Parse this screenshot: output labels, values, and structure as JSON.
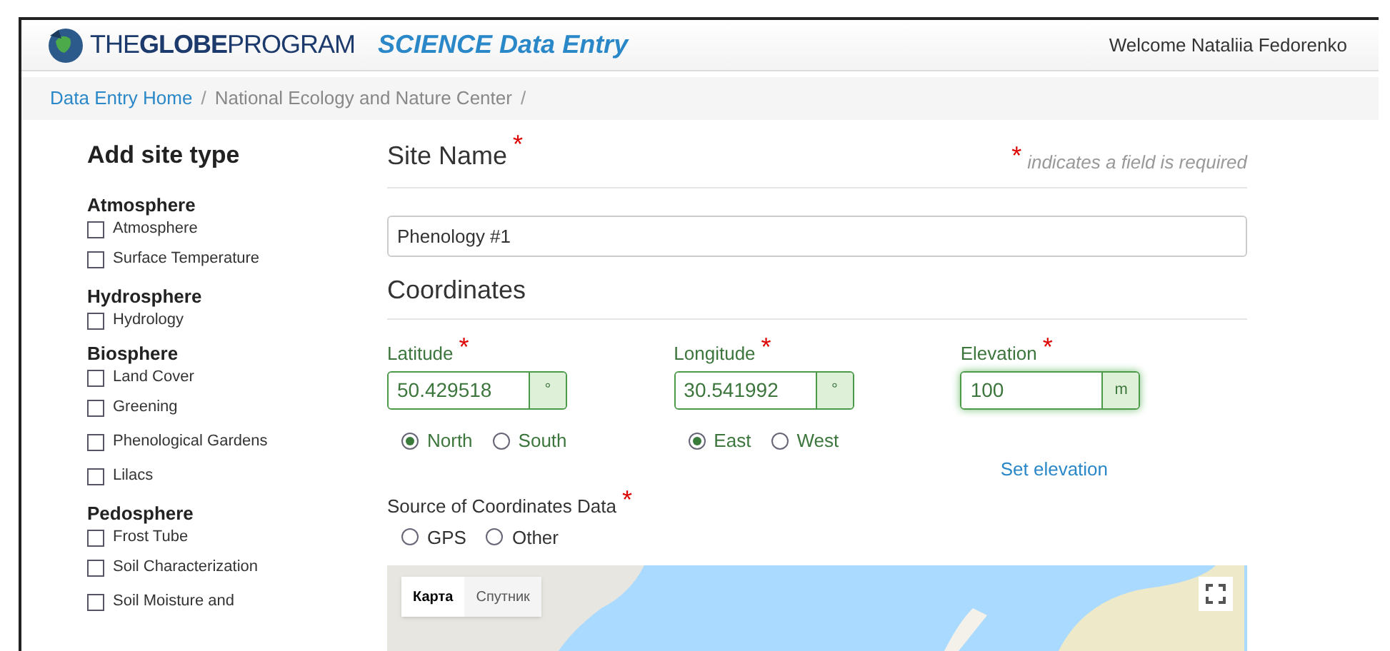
{
  "header": {
    "logo_text": "THE**GLOBE**PROGRAM",
    "app_title": "SCIENCE Data Entry",
    "welcome": "Welcome Nataliia Fedorenko"
  },
  "breadcrumb": [
    {
      "label": "Data Entry Home",
      "kind": "link"
    },
    {
      "label": "/",
      "kind": "separator"
    },
    {
      "label": "National Ecology and Nature Center",
      "kind": "text"
    },
    {
      "label": "/",
      "kind": "separator"
    }
  ],
  "sidebar": {
    "title": "Add site type",
    "groups": [
      {
        "name": "Atmosphere",
        "items": [
          {
            "label": "Atmosphere",
            "checked": false
          },
          {
            "label": "Surface Temperature",
            "checked": false
          }
        ]
      },
      {
        "name": "Hydrosphere",
        "items": [
          {
            "label": "Hydrology",
            "checked": false
          }
        ]
      },
      {
        "name": "Biosphere",
        "items": [
          {
            "label": "Land Cover",
            "checked": false
          },
          {
            "label": "Greening",
            "checked": false
          },
          {
            "label": "Phenological Gardens",
            "checked": false
          },
          {
            "label": "Lilacs",
            "checked": false
          }
        ]
      },
      {
        "name": "Pedosphere",
        "items": [
          {
            "label": "Frost Tube",
            "checked": false
          },
          {
            "label": "Soil Characterization",
            "checked": false
          },
          {
            "label": "Soil Moisture and",
            "checked": false
          }
        ]
      }
    ]
  },
  "form": {
    "site_name_label": "Site Name",
    "site_name_mark": "*",
    "required_note_mark": "*",
    "required_note": "indicates a field is required",
    "site_name_value": "Phenology #1",
    "coordinates_heading": "Coordinates",
    "fields": [
      {
        "label": "Latitude",
        "mark": "*",
        "value": "50.429518",
        "unit": "°",
        "focused": false,
        "options": [
          {
            "label": "North",
            "selected": true
          },
          {
            "label": "South",
            "selected": false
          }
        ]
      },
      {
        "label": "Longitude",
        "mark": "*",
        "value": "30.541992",
        "unit": "°",
        "focused": false,
        "options": [
          {
            "label": "East",
            "selected": true
          },
          {
            "label": "West",
            "selected": false
          }
        ]
      },
      {
        "label": "Elevation",
        "mark": "*",
        "value": "100",
        "unit": "m",
        "focused": true,
        "link": "Set elevation"
      }
    ],
    "source_label": "Source of Coordinates Data",
    "source_mark": "*",
    "source_options": [
      {
        "label": "GPS",
        "selected": false
      },
      {
        "label": "Other",
        "selected": false
      }
    ]
  },
  "map": {
    "tabs": [
      {
        "label": "Карта",
        "selected": true
      },
      {
        "label": "Спутник",
        "selected": false
      }
    ]
  }
}
